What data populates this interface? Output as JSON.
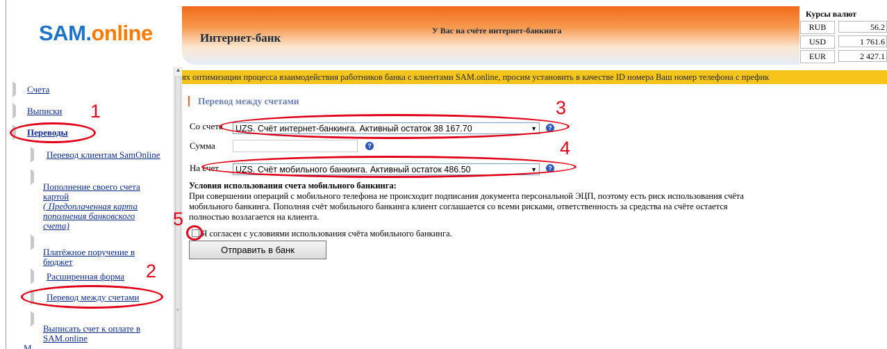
{
  "logo": {
    "sam": "SAM",
    "dot": ".",
    "online": "online"
  },
  "header": {
    "title": "Интернет-банк",
    "message": "У Вас на счёте интернет-банкинга"
  },
  "rates": {
    "title": "Курсы валют",
    "rows": [
      {
        "currency": "RUB",
        "value": "56.2"
      },
      {
        "currency": "USD",
        "value": "1 761.6"
      },
      {
        "currency": "EUR",
        "value": "2 427.1"
      }
    ]
  },
  "sidebar": {
    "items": [
      {
        "label": "Счета"
      },
      {
        "label": "Выписки"
      },
      {
        "label": "Переводы"
      }
    ],
    "sub": [
      {
        "label": "Перевод клиентам SamOnline"
      },
      {
        "label_lines": [
          "Пополнение своего счета",
          "картой"
        ],
        "note_lines": [
          "( Предоплаченная карта",
          "пополнения банковского",
          "счета)"
        ]
      },
      {
        "label_lines": [
          "Платёжное поручение в",
          "бюджет"
        ]
      },
      {
        "label": "Расширенная форма"
      },
      {
        "label": "Перевод между счетами"
      },
      {
        "label_lines": [
          "Выписать счет к оплате в",
          "SAM.online"
        ]
      }
    ],
    "cut_item": "M"
  },
  "marquee": "ях оптимизации процесса взаимодействия работников банка с клиентами SAM.online, просим установить в качестве ID номера Ваш номер телефона с префик",
  "form": {
    "section_title": "Перевод между счетами",
    "from_label": "Со счета",
    "from_value": "UZS. Счёт интернет-банкинга.   Активный остаток 38 167.70",
    "amount_label": "Сумма",
    "amount_value": "",
    "to_label": "На счет",
    "to_value": "UZS. Счёт мобильного банкинга.   Активный остаток 486.50",
    "conditions_title": "Условия использования счета мобильного банкинга:",
    "conditions_lines": [
      "При совершении операций с мобильного телефона не происходит подписания документа персональной ЭЦП, поэтому есть риск использования счёта",
      "мобильного банкинга. Пополняя счёт мобильного банкинга клиент соглашается со всеми рисками, ответственность за средства на счёте остается",
      "полностью возлагается на клиента."
    ],
    "agree_label": "Я согласен с условиями использования счёта мобильного банкинга.",
    "submit_label": "Отправить в банк"
  },
  "annotations": {
    "n1": "1",
    "n2": "2",
    "n3": "3",
    "n4": "4",
    "n5": "5"
  },
  "colors": {
    "annotation": "#e0001a",
    "link": "#0b2a8a",
    "marquee_bg": "#f7c519",
    "accent": "#e36a24"
  }
}
